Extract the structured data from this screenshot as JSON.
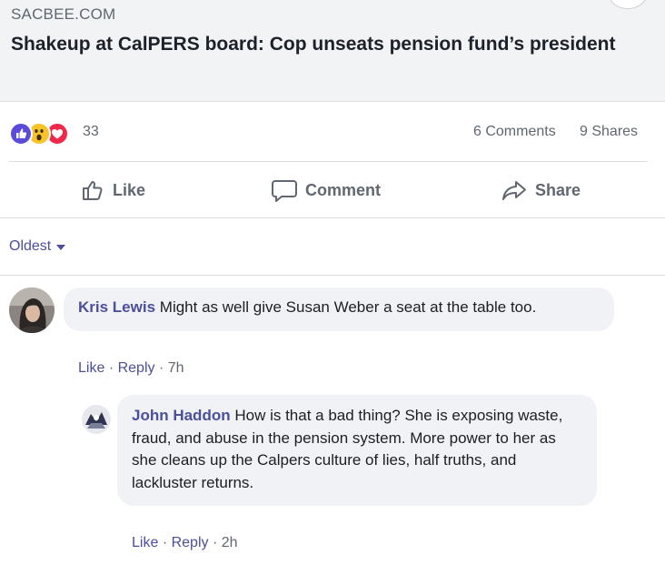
{
  "link_preview": {
    "domain": "SACBEE.COM",
    "headline": "Shakeup at CalPERS board: Cop unseats pension fund’s president"
  },
  "reactions": {
    "icons": [
      "like-icon",
      "wow-icon",
      "love-icon"
    ],
    "count": "33",
    "comments": "6 Comments",
    "shares": "9 Shares",
    "colors": {
      "like": "#5a4bd8",
      "wow": "#f7c325",
      "love": "#f0284a"
    }
  },
  "actions": {
    "like": "Like",
    "comment": "Comment",
    "share": "Share"
  },
  "sort": {
    "label": "Oldest"
  },
  "comments": [
    {
      "author": "Kris Lewis",
      "text": "Might as well give Susan Weber a seat at the table too.",
      "like": "Like",
      "reply": "Reply",
      "sep": "·",
      "time": "7h"
    },
    {
      "author": "John Haddon",
      "text": "How is that a bad thing? She is exposing waste, fraud, and abuse in the pension system. More power to her as she cleans up the Calpers culture of lies, half truths, and lackluster returns.",
      "like": "Like",
      "reply": "Reply",
      "sep": "·",
      "time": "2h"
    }
  ],
  "accent_color": "#4b4f9c"
}
